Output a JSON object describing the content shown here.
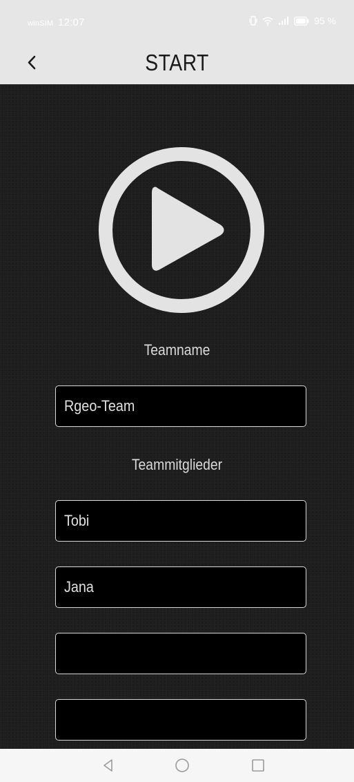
{
  "status_bar": {
    "carrier": "winSIM",
    "time": "12:07",
    "battery": "95 %"
  },
  "header": {
    "title": "START",
    "back_icon": "chevron-left-icon"
  },
  "main": {
    "play_icon": "play-circle-icon",
    "teamname_label": "Teamname",
    "teamname_value": "Rgeo-Team",
    "members_label": "Teammitglieder",
    "members": [
      "Tobi",
      "Jana",
      "",
      ""
    ]
  },
  "nav_bar": {
    "back_icon": "triangle-back-icon",
    "home_icon": "circle-home-icon",
    "recents_icon": "square-recents-icon"
  },
  "colors": {
    "background": "#1e1e1e",
    "header": "#e6e6e6",
    "field_bg": "#000000",
    "field_border": "#d8d8d8",
    "text_light": "#d9d9d9"
  }
}
